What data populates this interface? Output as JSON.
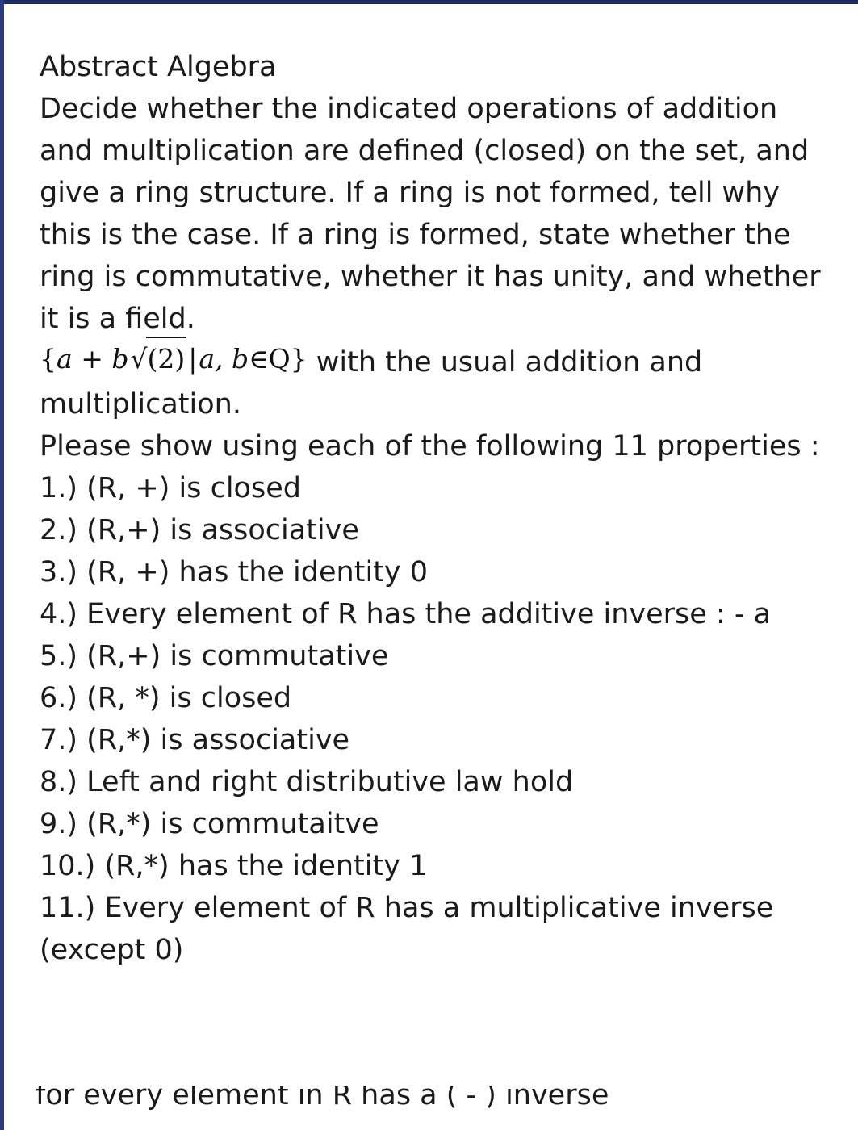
{
  "document": {
    "title": "Abstract Algebra",
    "intro_paragraph": "Decide whether the indicated operations of addition and multiplication are defined (closed) on the set, and give a ring structure. If a ring is not formed, tell why this is the case. If a ring is formed, state whether the ring is commutative, whether it has unity, and whether it is a field.",
    "set_expression": {
      "open_brace": "{",
      "a": "a",
      "plus": "+",
      "b": "b",
      "radical_sign": "√",
      "radicand": "(2)",
      "divider": "|",
      "vars": "a, b",
      "member": "∈",
      "field": "Q",
      "close_brace": "}",
      "trailing_text": " with the usual addition and multiplication."
    },
    "instruction": "Please show using each of the following 11 properties :",
    "properties": [
      "1.) (R, +) is closed",
      "2.) (R,+) is associative",
      "3.) (R, +) has the identity 0",
      "4.) Every element of R has the additive inverse : - a",
      "5.) (R,+) is commutative",
      "6.) (R, *) is closed",
      "7.) (R,*) is associative",
      "8.) Left and right distributive law hold",
      "9.) (R,*) is commutaitve",
      "10.) (R,*) has the identity 1",
      "11.) Every element of R has a multiplicative inverse (except 0)"
    ],
    "clipped_line": "for every element in R has a ( - ) inverse",
    "colors": {
      "page_background": "#ffffff",
      "text": "#1a1a1a",
      "top_bar": "#1b2a63"
    }
  }
}
